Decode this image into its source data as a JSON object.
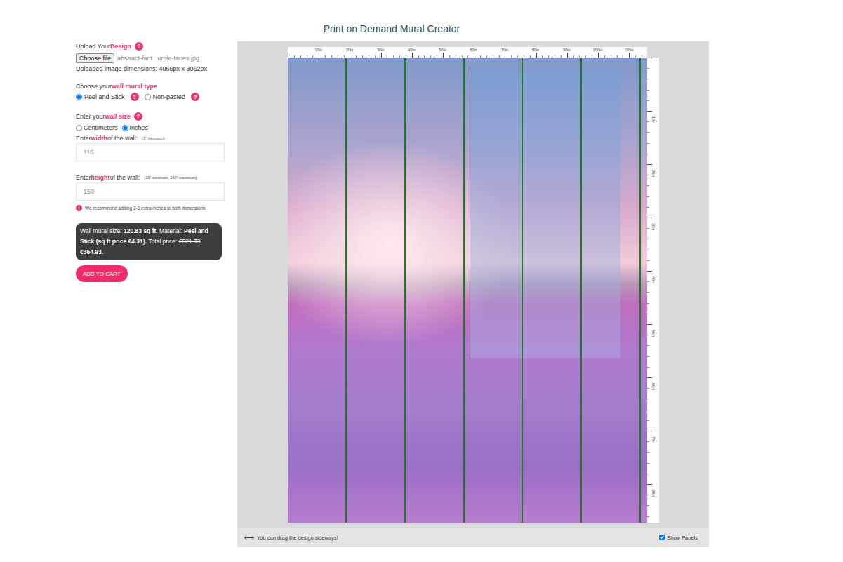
{
  "page": {
    "title": "Print on Demand Mural Creator"
  },
  "help_glyph": "?",
  "upload": {
    "label": "Upload Your ",
    "highlight": "Design",
    "button": "Choose file",
    "filename": "abstract-fant...urple-tanes.jpg",
    "dimensions": "Uploaded image dimensions: 4066px x 3062px"
  },
  "mural_type": {
    "label": "Choose your ",
    "highlight": "wall mural type",
    "options": [
      {
        "label": "Peel and Stick",
        "selected": true
      },
      {
        "label": "Non-pasted",
        "selected": false
      }
    ]
  },
  "wall_size": {
    "label": "Enter your ",
    "highlight": "wall size",
    "units": [
      {
        "label": "Centimeters",
        "selected": false
      },
      {
        "label": "Inches",
        "selected": true
      }
    ],
    "width": {
      "prefix": "Enter ",
      "highlight": "width",
      "suffix": " of the wall:",
      "hint": "(1\" minimum)",
      "value": "116"
    },
    "height": {
      "prefix": "Enter ",
      "highlight": "height",
      "suffix": " of the wall:",
      "hint": "(19\" minimum, 240\" maximum)",
      "value": "150"
    },
    "note": {
      "icon": "!",
      "text": "We recommend adding 2-3 extra inches to both dimensions"
    }
  },
  "summary": [
    {
      "text": "Wall mural size: ",
      "kind": "plain"
    },
    {
      "text": "120.83 sq ft.",
      "kind": "bold"
    },
    {
      "text": " Material: ",
      "kind": "plain"
    },
    {
      "text": "Peel and Stick (sq ft price €4.31).",
      "kind": "bold"
    },
    {
      "text": " Total price: ",
      "kind": "plain"
    },
    {
      "text": "€521.33",
      "kind": "struck"
    },
    {
      "text": " €364.93.",
      "kind": "bold"
    }
  ],
  "cart_button": "ADD TO CART",
  "ruler": {
    "top": [
      "10in",
      "20in",
      "30in",
      "40in",
      "50in",
      "60in",
      "70in",
      "80in",
      "90in",
      "100in",
      "110in"
    ],
    "side": [
      "10in",
      "20in",
      "30in",
      "40in",
      "50in",
      "60in",
      "70in",
      "80in"
    ]
  },
  "panel_lines": 6,
  "footer": {
    "icon": "⟷",
    "hint": "You can drag the design sideways!",
    "show_panels": {
      "label": "Show Panels",
      "checked": true
    }
  }
}
